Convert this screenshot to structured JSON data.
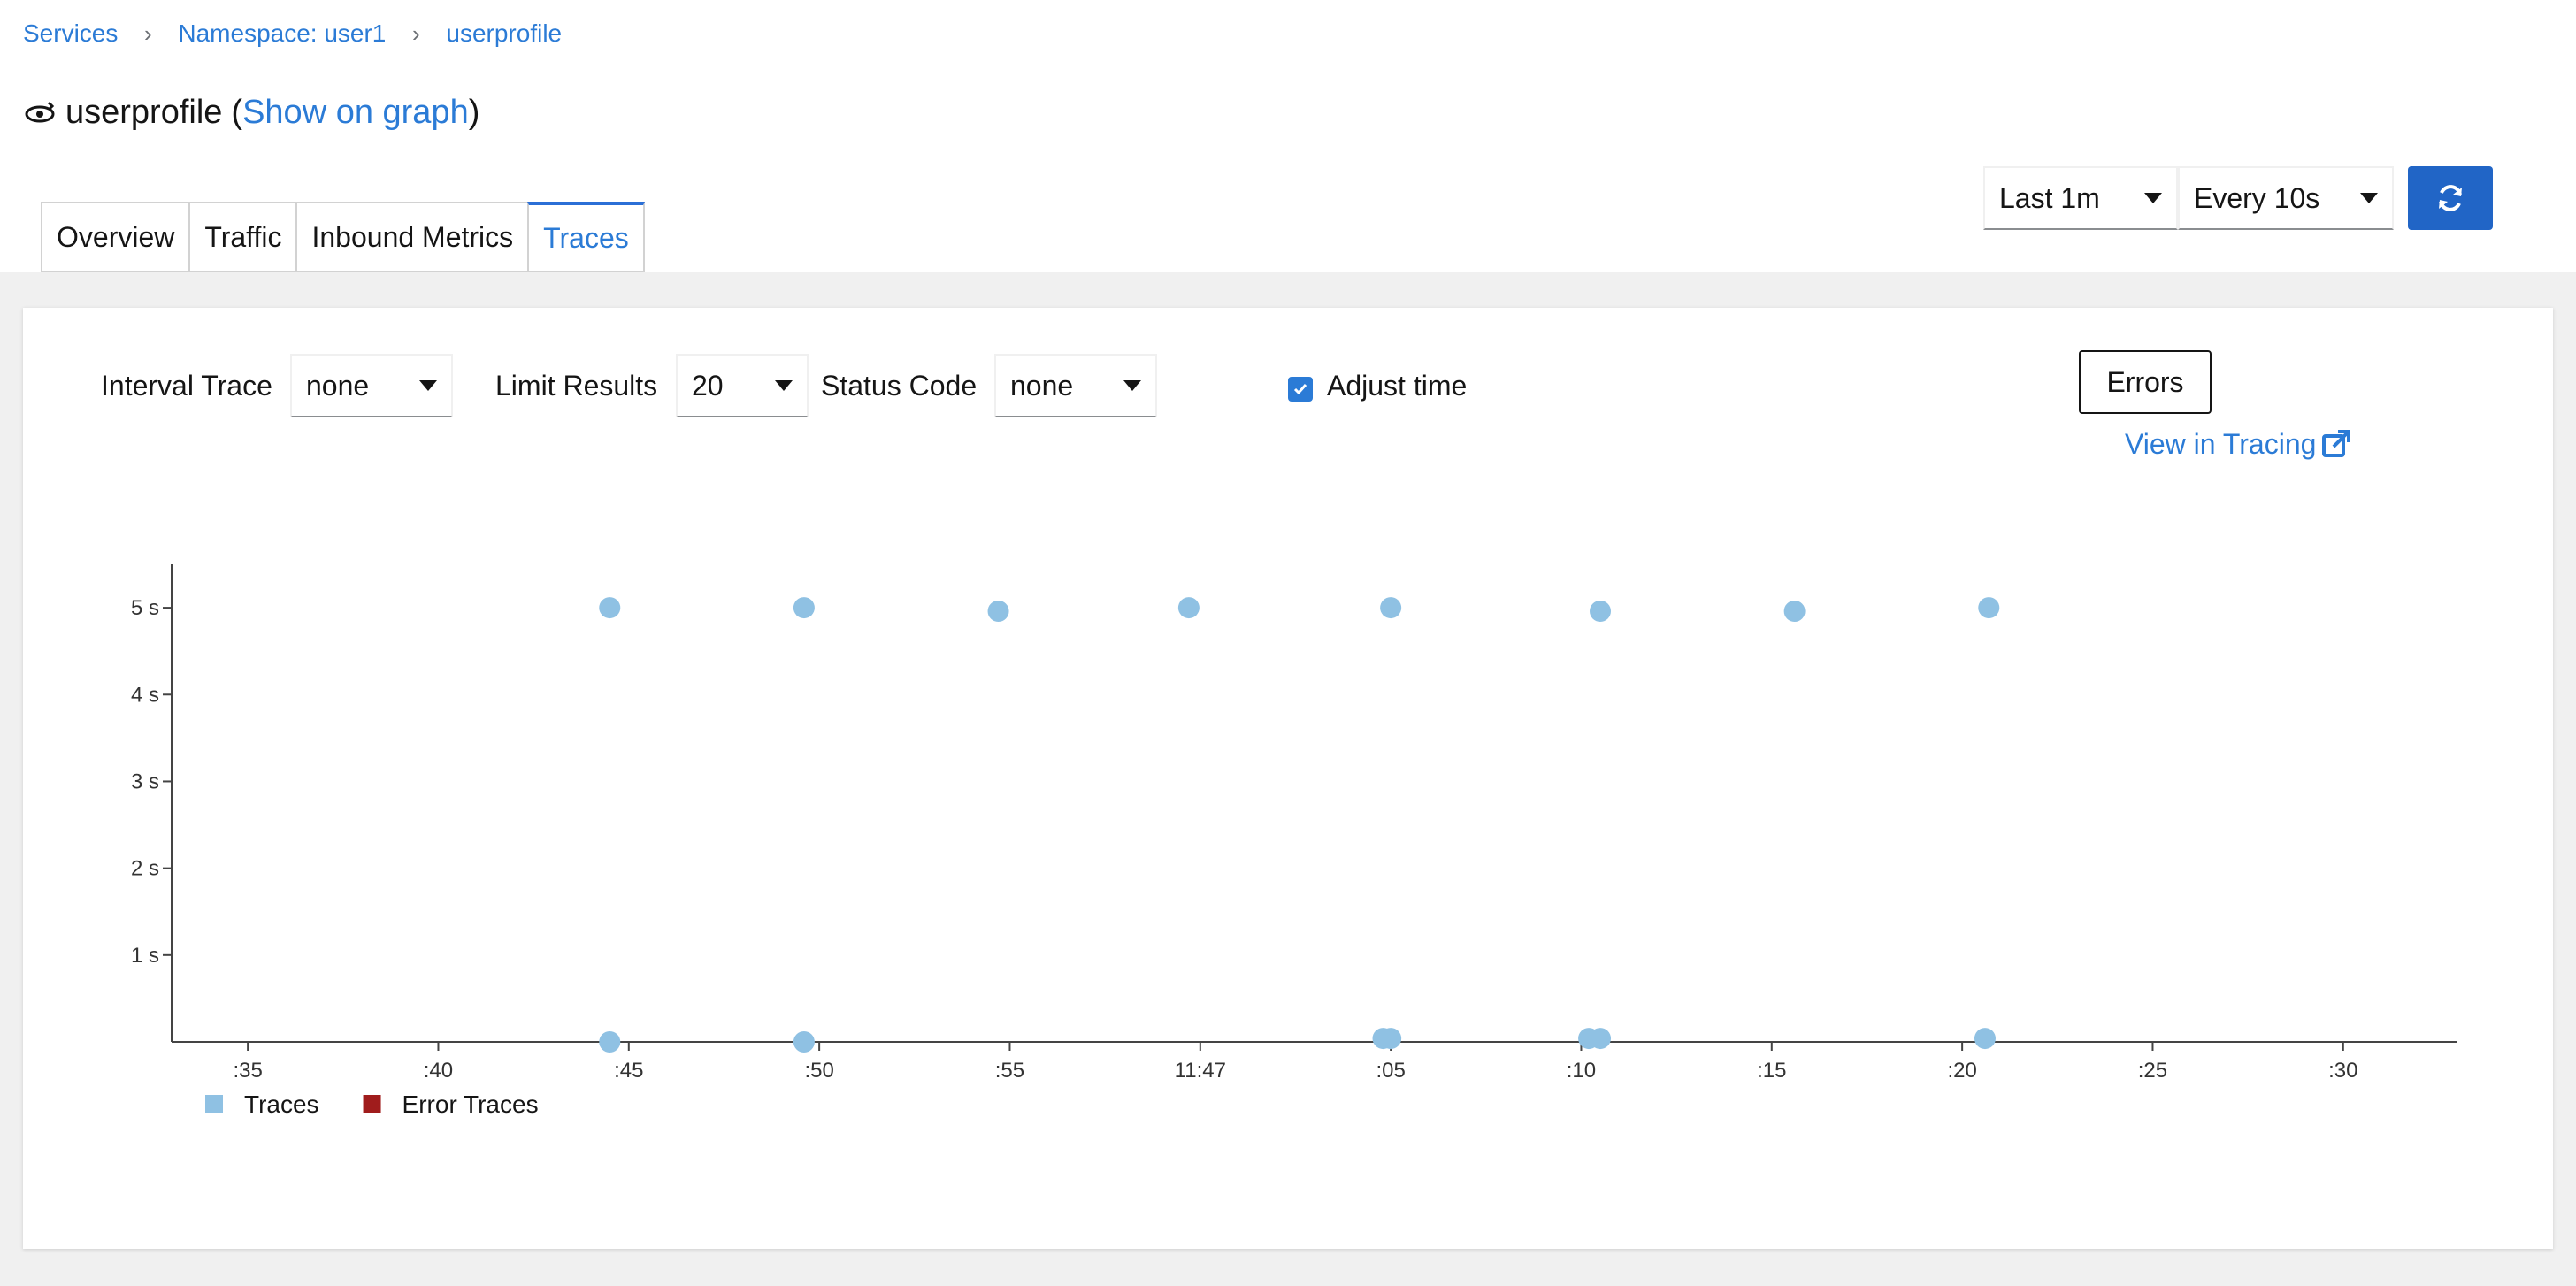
{
  "breadcrumb": {
    "items": [
      "Services",
      "Namespace: user1",
      "userprofile"
    ]
  },
  "title": {
    "service_name": "userprofile",
    "open_paren": "(",
    "link": "Show on graph",
    "close_paren": ")"
  },
  "tabs": [
    "Overview",
    "Traffic",
    "Inbound Metrics",
    "Traces"
  ],
  "active_tab": "Traces",
  "toolbar": {
    "duration": "Last 1m",
    "refresh_interval": "Every 10s",
    "refresh_icon": "sync-icon"
  },
  "filters": {
    "interval_trace_label": "Interval Trace",
    "interval_trace_value": "none",
    "limit_results_label": "Limit Results",
    "limit_results_value": "20",
    "status_code_label": "Status Code",
    "status_code_value": "none",
    "adjust_time_label": "Adjust time",
    "adjust_time_checked": true,
    "errors_button": "Errors",
    "view_in_tracing": "View in Tracing",
    "external_link_icon": "external-link-icon"
  },
  "colors": {
    "accent": "#2b7bd6",
    "button": "#2165c6",
    "traces": "#8fc1e3",
    "error_traces": "#a01c1c"
  },
  "chart_data": {
    "type": "scatter",
    "xlabel": "",
    "ylabel": "",
    "y_unit": "s",
    "y_ticks": [
      {
        "value": 1,
        "label": "1 s"
      },
      {
        "value": 2,
        "label": "2 s"
      },
      {
        "value": 3,
        "label": "3 s"
      },
      {
        "value": 4,
        "label": "4 s"
      },
      {
        "value": 5,
        "label": "5 s"
      }
    ],
    "ylim": [
      0,
      5.5
    ],
    "xlim": [
      "11:46:33",
      "11:47:33"
    ],
    "x_ticks": [
      {
        "value": "11:46:35",
        "label": ":35"
      },
      {
        "value": "11:46:40",
        "label": ":40"
      },
      {
        "value": "11:46:45",
        "label": ":45"
      },
      {
        "value": "11:46:50",
        "label": ":50"
      },
      {
        "value": "11:46:55",
        "label": ":55"
      },
      {
        "value": "11:47:00",
        "label": "11:47"
      },
      {
        "value": "11:47:05",
        "label": ":05"
      },
      {
        "value": "11:47:10",
        "label": ":10"
      },
      {
        "value": "11:47:15",
        "label": ":15"
      },
      {
        "value": "11:47:20",
        "label": ":20"
      },
      {
        "value": "11:47:25",
        "label": ":25"
      },
      {
        "value": "11:47:30",
        "label": ":30"
      }
    ],
    "grid": false,
    "legend_position": "bottom-left",
    "series": [
      {
        "name": "Traces",
        "color": "#8fc1e3",
        "points": [
          {
            "x": "11:46:44.5",
            "y": 5.0
          },
          {
            "x": "11:46:49.6",
            "y": 5.0
          },
          {
            "x": "11:46:54.7",
            "y": 4.96
          },
          {
            "x": "11:46:59.7",
            "y": 5.0
          },
          {
            "x": "11:47:05.0",
            "y": 5.0
          },
          {
            "x": "11:47:10.5",
            "y": 4.96
          },
          {
            "x": "11:47:15.6",
            "y": 4.96
          },
          {
            "x": "11:47:20.7",
            "y": 5.0
          },
          {
            "x": "11:46:44.5",
            "y": 0.0
          },
          {
            "x": "11:46:49.6",
            "y": 0.0
          },
          {
            "x": "11:47:04.8",
            "y": 0.04
          },
          {
            "x": "11:47:05.0",
            "y": 0.04
          },
          {
            "x": "11:47:10.2",
            "y": 0.04
          },
          {
            "x": "11:47:10.5",
            "y": 0.04
          },
          {
            "x": "11:47:20.6",
            "y": 0.04
          }
        ]
      },
      {
        "name": "Error Traces",
        "color": "#a01c1c",
        "points": []
      }
    ]
  }
}
